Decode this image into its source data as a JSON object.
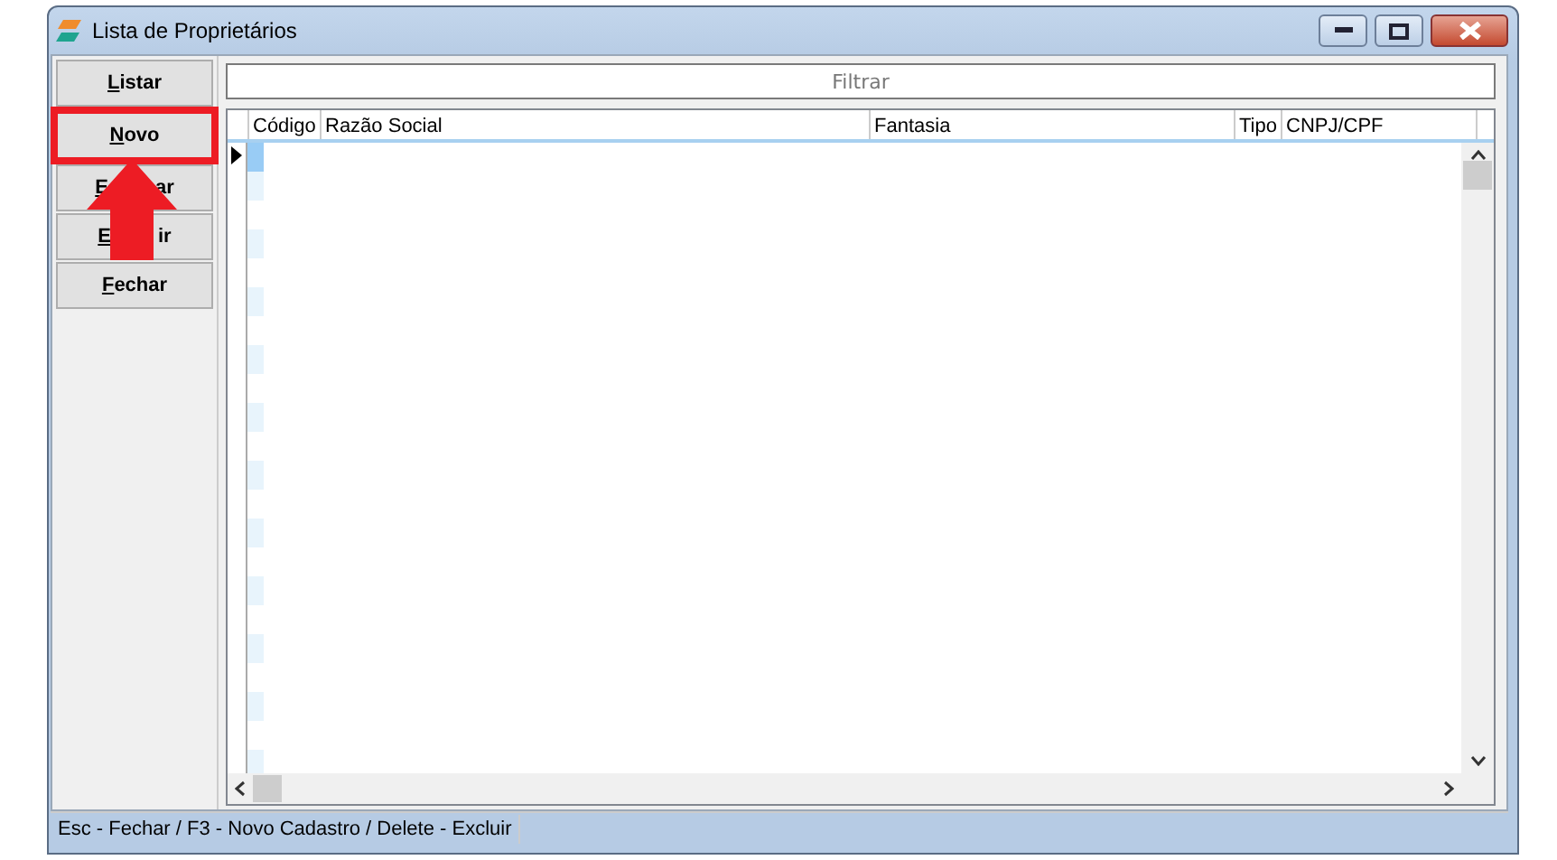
{
  "window": {
    "title": "Lista de Proprietários"
  },
  "buttons": [
    {
      "label_parts": [
        "Listar"
      ],
      "first_letter_underlined": true,
      "highlighted": false
    },
    {
      "label_parts": [
        "Novo"
      ],
      "first_letter_underlined": true,
      "highlighted": true
    },
    {
      "label_parts": [
        "E",
        "ar"
      ],
      "first_letter_underlined": true,
      "highlighted": false
    },
    {
      "label_parts": [
        "E",
        "ir"
      ],
      "first_letter_underlined": true,
      "highlighted": false
    },
    {
      "label_parts": [
        "Fechar"
      ],
      "first_letter_underlined": true,
      "highlighted": false
    }
  ],
  "annotation": {
    "kind": "arrow"
  },
  "filter": {
    "placeholder": "Filtrar"
  },
  "table": {
    "columns": [
      "Código",
      "Razão Social",
      "Fantasia",
      "Tipo",
      "CNPJ/CPF"
    ]
  },
  "status_bar": "Esc - Fechar / F3 - Novo Cadastro / Delete - Excluir"
}
